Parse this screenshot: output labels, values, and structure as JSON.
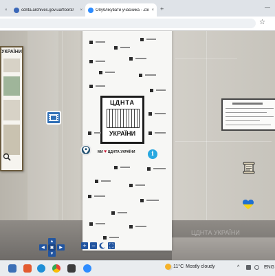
{
  "browser": {
    "tabs": [
      {
        "title": "",
        "favicon_color": "#5f6368",
        "active": false
      },
      {
        "title": "cdnta.archives.gov.ua/floor3/",
        "favicon_color": "#3a67b8",
        "active": false
      },
      {
        "title": "Опублікувати учасника - Zoo",
        "favicon_color": "#2d8cff",
        "active": true
      }
    ],
    "close_glyph": "×",
    "new_tab_glyph": "+",
    "minimize_glyph": "—",
    "star_glyph": "☆"
  },
  "scene": {
    "left_poster_title": "УКРАЇНИ",
    "banner_logo_top": "ЦДНТА",
    "banner_logo_bottom": "УКРАЇНИ",
    "banner_love_prefix": "МИ",
    "banner_love_heart": "♥",
    "banner_love_suffix": "ЦДНТА УКРАЇНИ",
    "watermark": "ЦДНТА УКРАЇНИ",
    "hotspots": {
      "film_icon": "film-icon",
      "pin_icon": "map-pin-icon",
      "info_label": "i",
      "scroll_icon": "scroll-icon",
      "heart_icon": "ukraine-heart-icon",
      "zoom_icon": "magnifier-icon"
    }
  },
  "controls": {
    "nav_up": "▲",
    "nav_down": "▼",
    "nav_left": "◀",
    "nav_right": "▶",
    "nav_center": "▣",
    "zoom_in": "+",
    "zoom_out": "−",
    "fullscreen": "⛶"
  },
  "taskbar": {
    "weather_temp": "11°C",
    "weather_desc": "Mostly cloudy",
    "tray_chevron": "^",
    "language": "ENG",
    "accent": "#0078d4"
  }
}
